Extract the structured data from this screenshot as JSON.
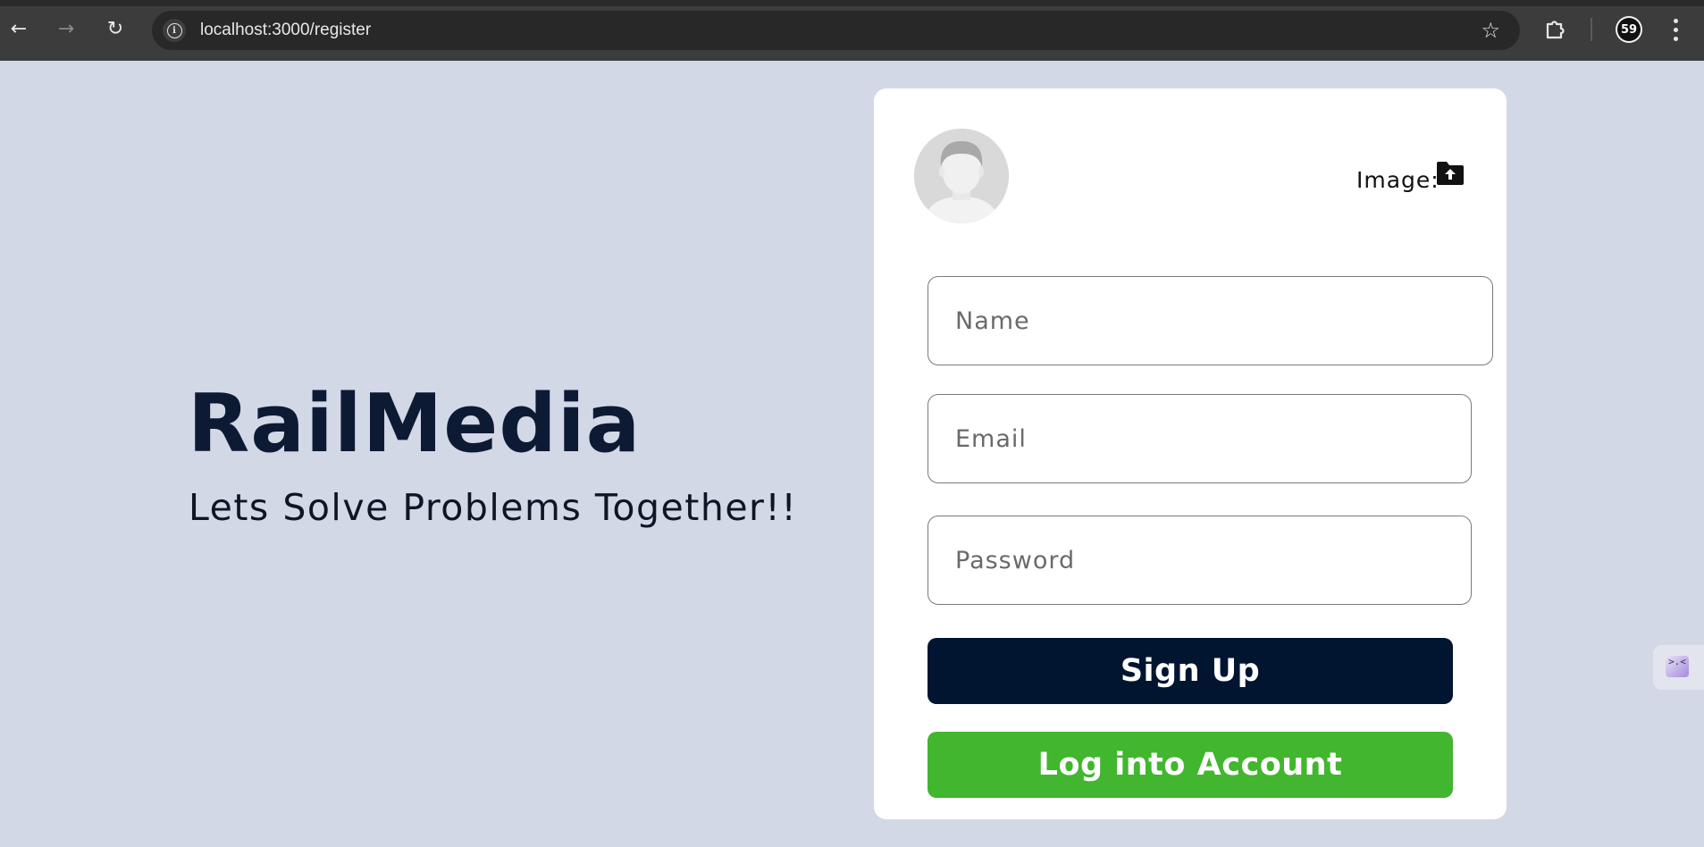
{
  "browser": {
    "url": "localhost:3000/register",
    "profile_initials": "59",
    "back_glyph": "←",
    "forward_glyph": "→",
    "reload_glyph": "↻",
    "info_glyph": "i",
    "bookmark_glyph": "☆"
  },
  "hero": {
    "title": "RailMedia",
    "subtitle": "Lets Solve Problems Together!!"
  },
  "form": {
    "image_label": "Image:",
    "name_placeholder": "Name",
    "email_placeholder": "Email",
    "password_placeholder": "Password",
    "signup_label": "Sign Up",
    "login_label": "Log into Account"
  },
  "side_widget": {
    "glyph": ">.<"
  },
  "colors": {
    "page_bg": "#d3d8e7",
    "title": "#0d1a33",
    "signup_bg": "#021530",
    "login_bg": "#41b62e"
  }
}
